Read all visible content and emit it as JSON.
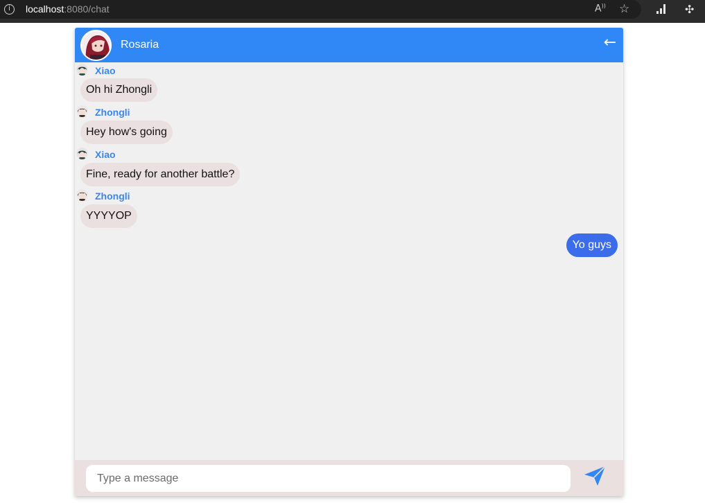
{
  "browser": {
    "url_host": "localhost",
    "url_rest": ":8080/chat"
  },
  "chat": {
    "title": "Rosaria",
    "input_placeholder": "Type a message",
    "colors": {
      "header": "#2f88f5",
      "incoming_bubble": "#ebe0e0",
      "outgoing_bubble": "#3b6cea",
      "sender_name": "#3b86e8",
      "background": "#f0f0f0"
    },
    "messages": [
      {
        "sender": "Xiao",
        "text": "Oh hi Zhongli"
      },
      {
        "sender": "Zhongli",
        "text": "Hey how's going"
      },
      {
        "sender": "Xiao",
        "text": "Fine, ready for another battle?"
      },
      {
        "sender": "Zhongli",
        "text": "YYYYOP"
      }
    ],
    "own_messages": [
      {
        "text": "Yo guys"
      }
    ]
  },
  "icons": [
    "info-icon",
    "read-aloud-icon",
    "favorite-icon",
    "extension-bars-icon",
    "extensions-puzzle-icon",
    "avatar",
    "back-arrow-icon",
    "send-icon"
  ]
}
